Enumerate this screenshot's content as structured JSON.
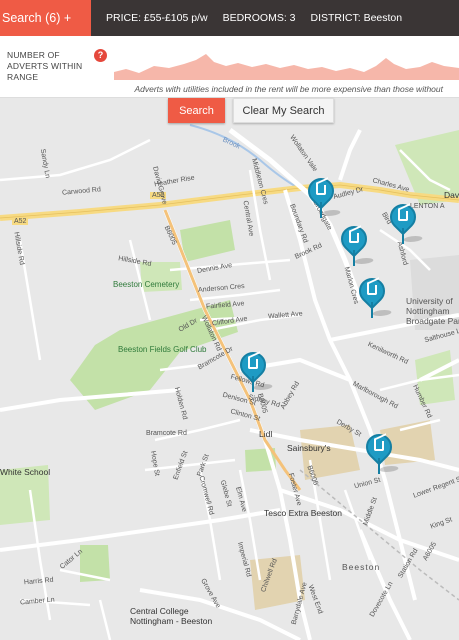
{
  "topbar": {
    "search_label": "Search (6) +",
    "price": "PRICE: £55-£105 p/w",
    "bedrooms": "BEDROOMS: 3",
    "district": "DISTRICT: Beeston"
  },
  "panel": {
    "label": "NUMBER OF ADVERTS WITHIN RANGE",
    "help": "?",
    "note": "Adverts with utilities included in the rent will be more expensive than those without"
  },
  "buttons": {
    "search": "Search",
    "clear": "Clear My Search"
  },
  "colors": {
    "accent": "#ef5b45",
    "topbar": "#3a3535",
    "marker": "#1e9bc4",
    "park": "#b9dca0",
    "road_major": "#f7da82"
  },
  "map": {
    "labels": {
      "dav": "Dav",
      "lenton": "LENTON A",
      "uni": "University of Nottingham Broadgate Park",
      "beeston_cemetery": "Beeston Cemetery",
      "golf_club": "Beeston Fields Golf Club",
      "white_school": "White School",
      "lidl": "Lidl",
      "sainsburys": "Sainsbury's",
      "tesco": "Tesco Extra Beeston",
      "beeston": "Beeston",
      "central_college": "Central College Nottingham - Beeston",
      "a52": "A52",
      "b6005": "B6005",
      "b6006": "B6006",
      "a6005": "A6005",
      "brook": "Brook",
      "wollaton_vale": "Wollaton Vale",
      "middleton_cres": "Middleton Cres",
      "boundary_rd": "Boundary Rd",
      "broadgate": "Broadgate",
      "audley_dr": "Audley Dr",
      "charles_ave": "Charles Ave",
      "bird": "Bird",
      "ashford": "Ashford",
      "hillside_rd": "Hillside Rd",
      "dennis_ave": "Dennis Ave",
      "anderson_cres": "Anderson Cres",
      "fairfield_ave": "Fairfield Ave",
      "clifford_ave": "Clifford Ave",
      "old_dr": "Old Dr",
      "wollaton_rd": "Wollaton Rd",
      "central_ave": "Central Ave",
      "david_grove": "David Grove",
      "heather_rise": "Heather Rise",
      "carwood_rd": "Carwood Rd",
      "sandy_ln": "Sandy Ln",
      "brook_rd": "Brook Rd",
      "marlon_cres": "Marlon Cres",
      "wallett_ave": "Wallett Ave",
      "salthouse_ln": "Salthouse Ln",
      "marlborough_rd": "Marlborough Rd",
      "humber_rd": "Humber Rd",
      "kenilworth_rd": "Kenilworth Rd",
      "derby_st": "Derby St",
      "fellows_rd": "Fellows Rd",
      "denison_st": "Denison St",
      "clinton_st": "Clinton St",
      "sidney_rd": "Sidney Rd",
      "abbey_rd": "Abbey Rd",
      "bramcote_rd": "Bramcote Rd",
      "bramcote_dr": "Bramcote Dr",
      "holden_rd": "Holden Rd",
      "hope_st": "Hope St",
      "enfield_st": "Enfield St",
      "park_st": "Park St",
      "cromwell_rd": "Cromwell Rd",
      "glebe_st": "Glebe St",
      "elm_ave": "Elm Ave",
      "foster_ave": "Foster Ave",
      "union_st": "Union St",
      "middle_st": "Middle St",
      "lower_regent_st": "Lower Regent St",
      "king_st": "King St",
      "imperial_rd": "Imperial Rd",
      "chilwell_rd": "Chilwell Rd",
      "grove_ave": "Grove Ave",
      "harris_rd": "Harris Rd",
      "camber_ln": "Camber Ln",
      "cator_ln": "Cator Ln",
      "dovecote_ln": "Dovecote Ln",
      "barrydale_ave": "Barrydale Ave",
      "station_rd": "Station Rd",
      "west_end": "West End"
    }
  },
  "markers": [
    {
      "name": "marker-1",
      "icon": "house-icon"
    },
    {
      "name": "marker-2",
      "icon": "house-icon"
    },
    {
      "name": "marker-3",
      "icon": "house-icon"
    },
    {
      "name": "marker-4",
      "icon": "house-icon"
    },
    {
      "name": "marker-5",
      "icon": "house-icon"
    },
    {
      "name": "marker-6",
      "icon": "house-icon"
    }
  ]
}
